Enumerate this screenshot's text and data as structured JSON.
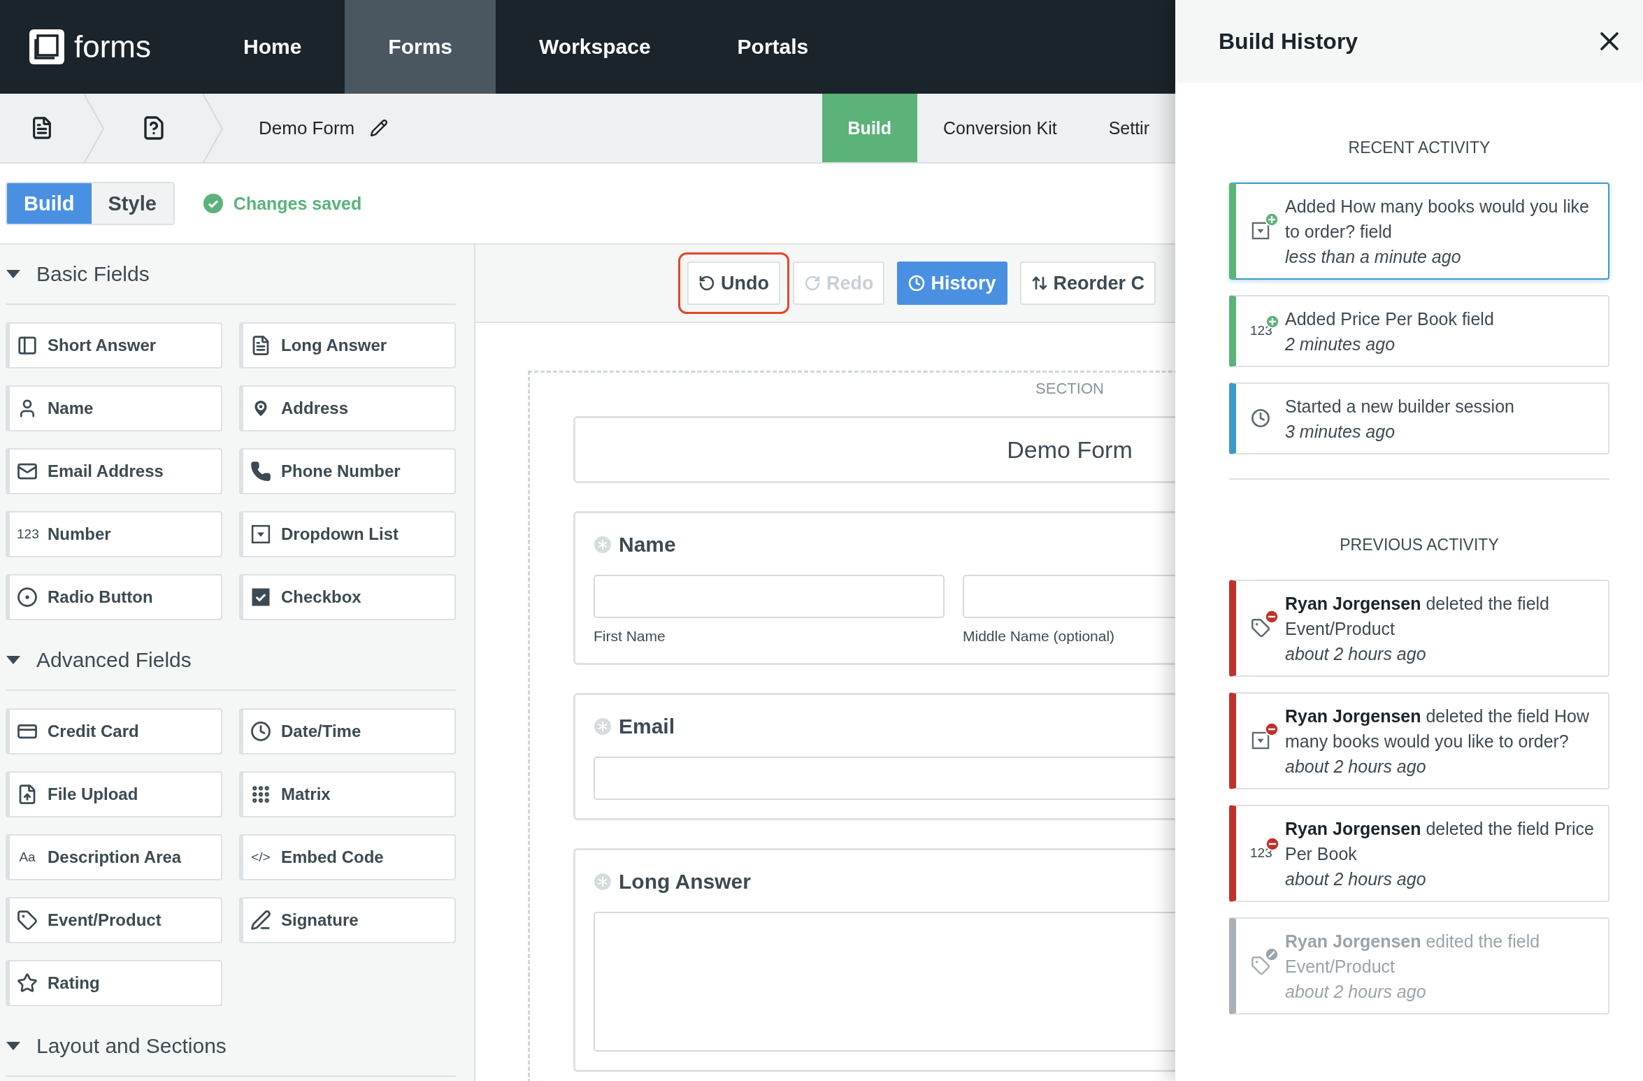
{
  "nav": {
    "logo": "forms",
    "tabs": [
      {
        "label": "Home",
        "selected": false
      },
      {
        "label": "Forms",
        "selected": true
      },
      {
        "label": "Workspace",
        "selected": false
      },
      {
        "label": "Portals",
        "selected": false
      }
    ]
  },
  "breadcrumb": {
    "form_name": "Demo Form"
  },
  "mode_tabs": [
    {
      "label": "Build",
      "selected": true
    },
    {
      "label": "Conversion Kit",
      "selected": false
    },
    {
      "label": "Settir",
      "selected": false
    }
  ],
  "editor_tabs": [
    {
      "label": "Build",
      "selected": true
    },
    {
      "label": "Style",
      "selected": false
    }
  ],
  "save_status": "Changes saved",
  "field_groups": [
    {
      "title": "Basic Fields",
      "expanded": true,
      "fields": [
        {
          "label": "Short Answer",
          "kind": "short"
        },
        {
          "label": "Long Answer",
          "kind": "long"
        },
        {
          "label": "Name",
          "kind": "name"
        },
        {
          "label": "Address",
          "kind": "address"
        },
        {
          "label": "Email Address",
          "kind": "email"
        },
        {
          "label": "Phone Number",
          "kind": "phone"
        },
        {
          "label": "Number",
          "kind": "glyph",
          "glyph": "123"
        },
        {
          "label": "Dropdown List",
          "kind": "dropdown"
        },
        {
          "label": "Radio Button",
          "kind": "radio"
        },
        {
          "label": "Checkbox",
          "kind": "checkbox"
        }
      ]
    },
    {
      "title": "Advanced Fields",
      "expanded": true,
      "fields": [
        {
          "label": "Credit Card",
          "kind": "card"
        },
        {
          "label": "Date/Time",
          "kind": "clock"
        },
        {
          "label": "File Upload",
          "kind": "upload"
        },
        {
          "label": "Matrix",
          "kind": "matrix"
        },
        {
          "label": "Description Area",
          "kind": "glyph",
          "glyph": "Aa"
        },
        {
          "label": "Embed Code",
          "kind": "glyph",
          "glyph": "</>"
        },
        {
          "label": "Event/Product",
          "kind": "tag"
        },
        {
          "label": "Signature",
          "kind": "signature"
        },
        {
          "label": "Rating",
          "kind": "star"
        }
      ]
    },
    {
      "title": "Layout and Sections",
      "expanded": true
    }
  ],
  "toolbar": [
    {
      "label": "Undo",
      "kind": "undo",
      "selected": false,
      "disabled": false,
      "highlighted": true
    },
    {
      "label": "Redo",
      "kind": "redo",
      "selected": false,
      "disabled": true,
      "highlighted": false
    },
    {
      "label": "History",
      "kind": "history",
      "selected": true,
      "disabled": false,
      "highlighted": false
    },
    {
      "label": "Reorder C",
      "kind": "reorder",
      "selected": false,
      "disabled": false,
      "highlighted": false
    }
  ],
  "form": {
    "section_label": "SECTION",
    "title": "Demo Form",
    "fields": [
      {
        "label": "Name",
        "kind": "split",
        "inputs": [
          {
            "caption": "First Name"
          },
          {
            "caption": "Middle Name (optional)"
          }
        ]
      },
      {
        "label": "Email",
        "kind": "single"
      },
      {
        "label": "Long Answer",
        "kind": "textarea"
      }
    ]
  },
  "history": {
    "title": "Build History",
    "sections": [
      {
        "heading": "RECENT ACTIVITY",
        "items": [
          {
            "kind": "added",
            "field": {
              "kind": "dropdown"
            },
            "text": "Added How many books would you like to order? field",
            "time": "less than a minute ago",
            "selected": true
          },
          {
            "kind": "added",
            "field": {
              "kind": "glyph",
              "glyph": "123"
            },
            "text": "Added Price Per Book field",
            "time": "2 minutes ago",
            "selected": false
          },
          {
            "kind": "session",
            "field": {
              "kind": "clock"
            },
            "text": "Started a new builder session",
            "time": "3 minutes ago",
            "selected": false
          }
        ]
      },
      {
        "heading": "PREVIOUS ACTIVITY",
        "items": [
          {
            "kind": "deleted",
            "field": {
              "kind": "tag"
            },
            "text": "**Ryan Jorgensen** deleted the field Event/Product",
            "time": "about 2 hours ago",
            "selected": false
          },
          {
            "kind": "deleted",
            "field": {
              "kind": "dropdown"
            },
            "text": "**Ryan Jorgensen** deleted the field How many books would you like to order?",
            "time": "about 2 hours ago",
            "selected": false
          },
          {
            "kind": "deleted",
            "field": {
              "kind": "glyph",
              "glyph": "123"
            },
            "text": "**Ryan Jorgensen** deleted the field Price Per Book",
            "time": "about 2 hours ago",
            "selected": false
          },
          {
            "kind": "edited",
            "field": {
              "kind": "tag"
            },
            "text": "**Ryan Jorgensen** edited the field Event/Product",
            "time": "about 2 hours ago",
            "selected": false
          }
        ]
      }
    ]
  }
}
